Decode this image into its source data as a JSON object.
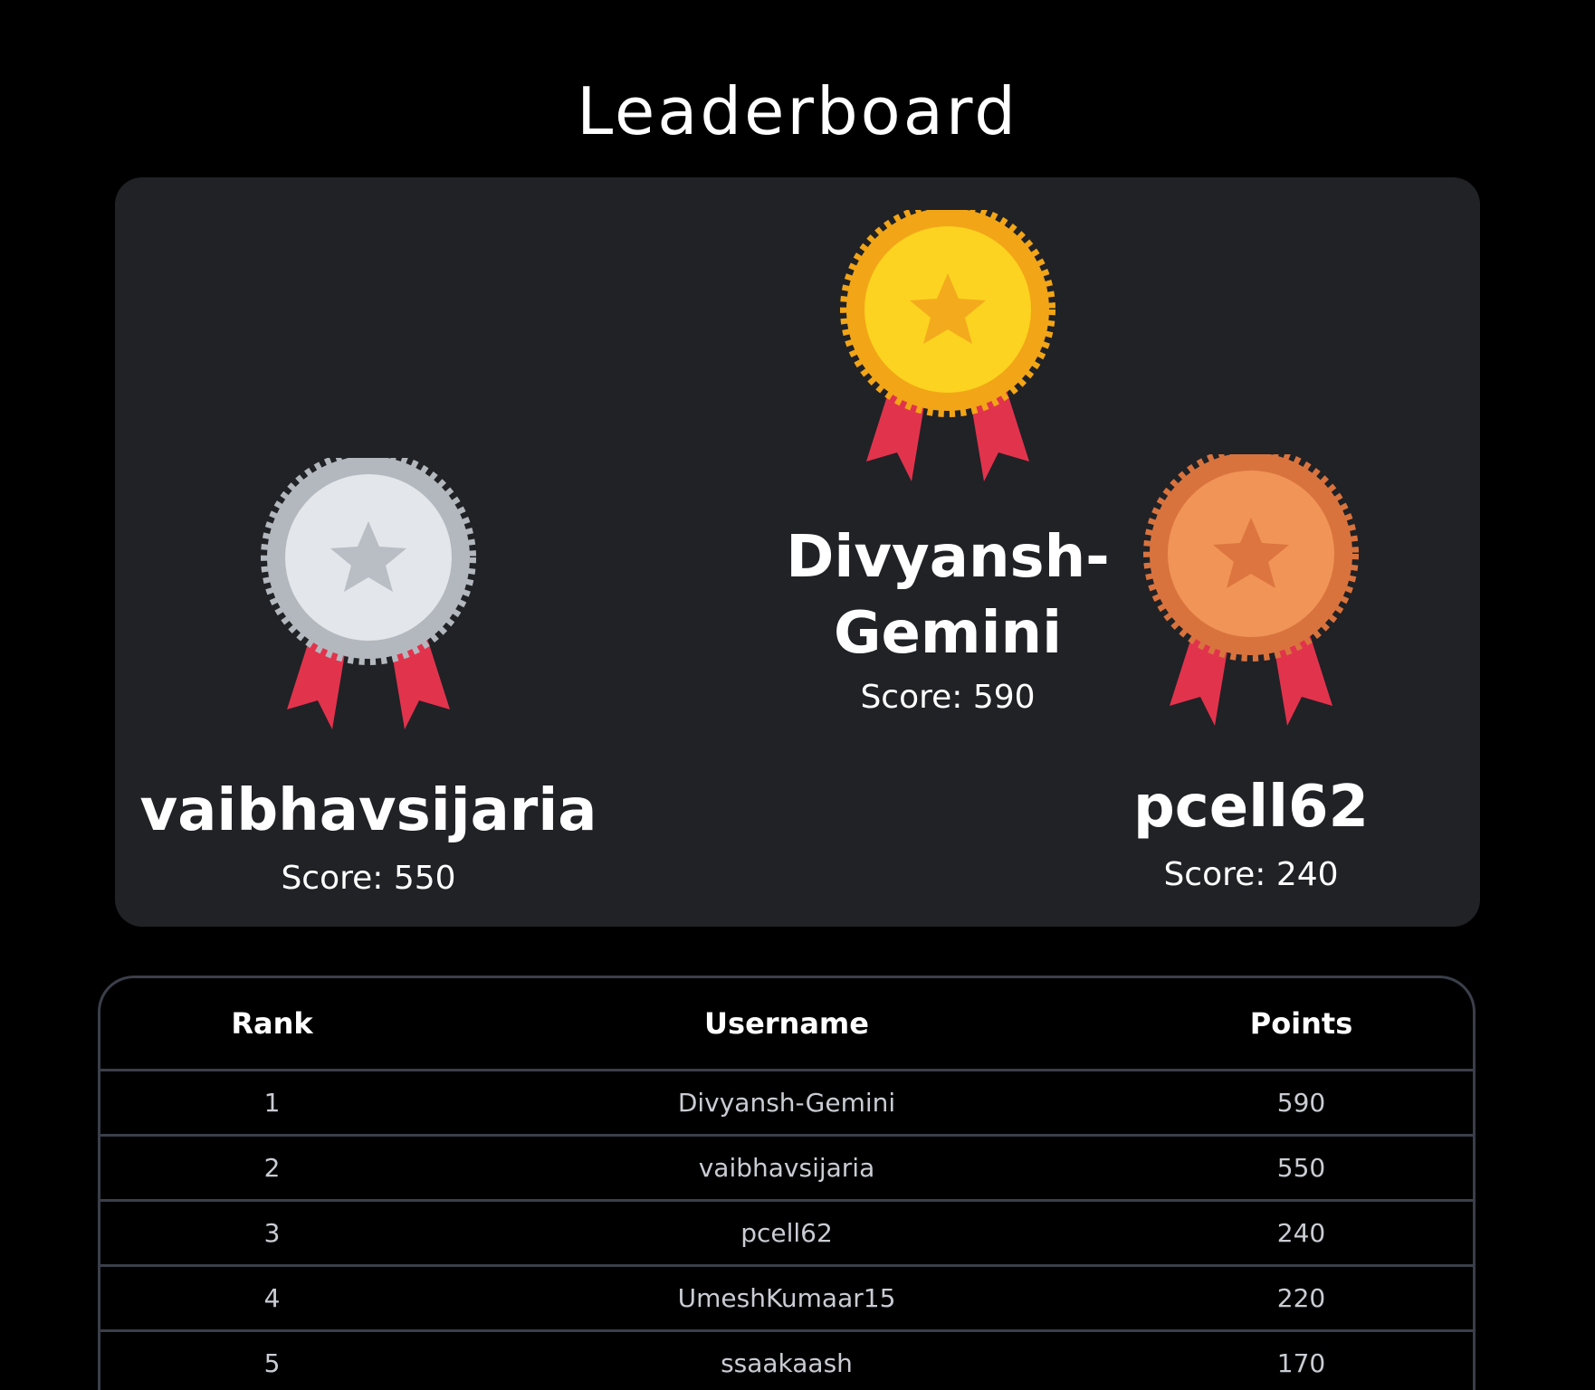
{
  "page": {
    "title": "Leaderboard"
  },
  "podium": {
    "first": {
      "name": "Divyansh-Gemini",
      "score": "Score: 590",
      "medal": "gold-medal-icon"
    },
    "second": {
      "name": "vaibhavsijaria",
      "score": "Score: 550",
      "medal": "silver-medal-icon"
    },
    "third": {
      "name": "pcell62",
      "score": "Score: 240",
      "medal": "bronze-medal-icon"
    }
  },
  "table": {
    "headers": {
      "rank": "Rank",
      "username": "Username",
      "points": "Points"
    },
    "rows": [
      {
        "rank": "1",
        "username": "Divyansh-Gemini",
        "points": "590"
      },
      {
        "rank": "2",
        "username": "vaibhavsijaria",
        "points": "550"
      },
      {
        "rank": "3",
        "username": "pcell62",
        "points": "240"
      },
      {
        "rank": "4",
        "username": "UmeshKumaar15",
        "points": "220"
      },
      {
        "rank": "5",
        "username": "ssaakaash",
        "points": "170"
      }
    ]
  },
  "colors": {
    "background": "#000000",
    "card": "#202226",
    "border": "#3a3f4a",
    "gold": "#f7c31a",
    "silver": "#cfd3d8",
    "bronze": "#ea8a52",
    "ribbon": "#e2334d"
  }
}
